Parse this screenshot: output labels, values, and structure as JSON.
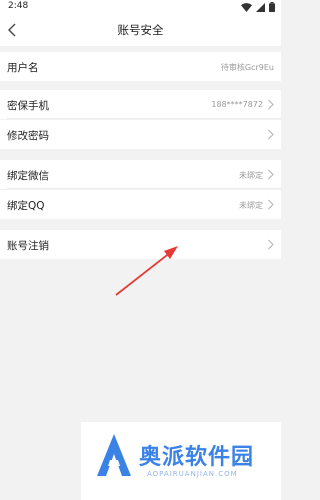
{
  "status_bar": {
    "time": "2:48"
  },
  "header": {
    "title": "账号安全"
  },
  "rows": {
    "username": {
      "label": "用户名",
      "value": "待审核Gcr9Eu"
    },
    "phone": {
      "label": "密保手机",
      "value": "188****7872"
    },
    "password": {
      "label": "修改密码"
    },
    "wechat": {
      "label": "绑定微信",
      "value": "未绑定"
    },
    "qq": {
      "label": "绑定QQ",
      "value": "未绑定"
    },
    "cancel_account": {
      "label": "账号注销"
    }
  },
  "watermark": {
    "name": "奥派软件园",
    "sub": "AOPAIRUANJIAN.COM"
  },
  "colors": {
    "annotation_arrow": "#e53935",
    "watermark_blue": "#3b82e6"
  }
}
